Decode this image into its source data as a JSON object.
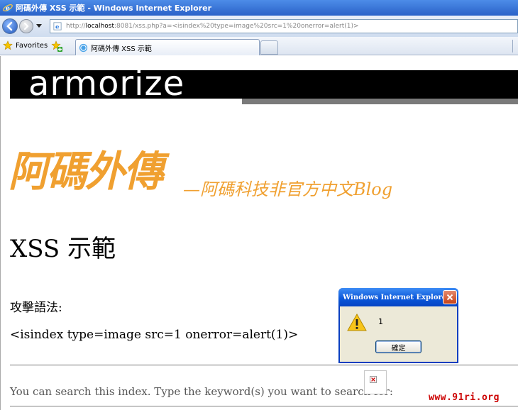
{
  "window": {
    "title": "阿碼外傳 XSS 示範 - Windows Internet Explorer"
  },
  "address": {
    "scheme": "http://",
    "host": "localhost",
    "rest": ":8081/xss.php?a=<isindex%20type=image%20src=1%20onerror=alert(1)>"
  },
  "favorites": {
    "label": "Favorites"
  },
  "tabs": [
    {
      "label": "阿碼外傳 XSS 示範"
    }
  ],
  "page": {
    "banner_text": "armorize",
    "blog_logo_main": "阿碼外傳",
    "blog_logo_sub": "—阿碼科技非官方中文Blog",
    "title": "XSS 示範",
    "attack_label": "攻擊語法:",
    "attack_code": "<isindex type=image src=1 onerror=alert(1)>",
    "search_prompt": "You can search this index. Type the keyword(s) you want to search for:"
  },
  "dialog": {
    "title": "Windows Internet Explorer",
    "message": "1",
    "ok_label": "確定"
  },
  "watermark": "www.91ri.org",
  "colors": {
    "logo_orange": "#f0a030",
    "titlebar_blue": "#2a62c8",
    "watermark_red": "#cc0000"
  },
  "icons": {
    "title": "ie-icon",
    "back": "back-arrow-icon",
    "forward": "forward-arrow-icon",
    "favorites": "star-icon",
    "add_favorite": "add-favorite-icon",
    "warning": "warning-icon",
    "close": "close-icon",
    "broken_image": "broken-image-icon"
  }
}
